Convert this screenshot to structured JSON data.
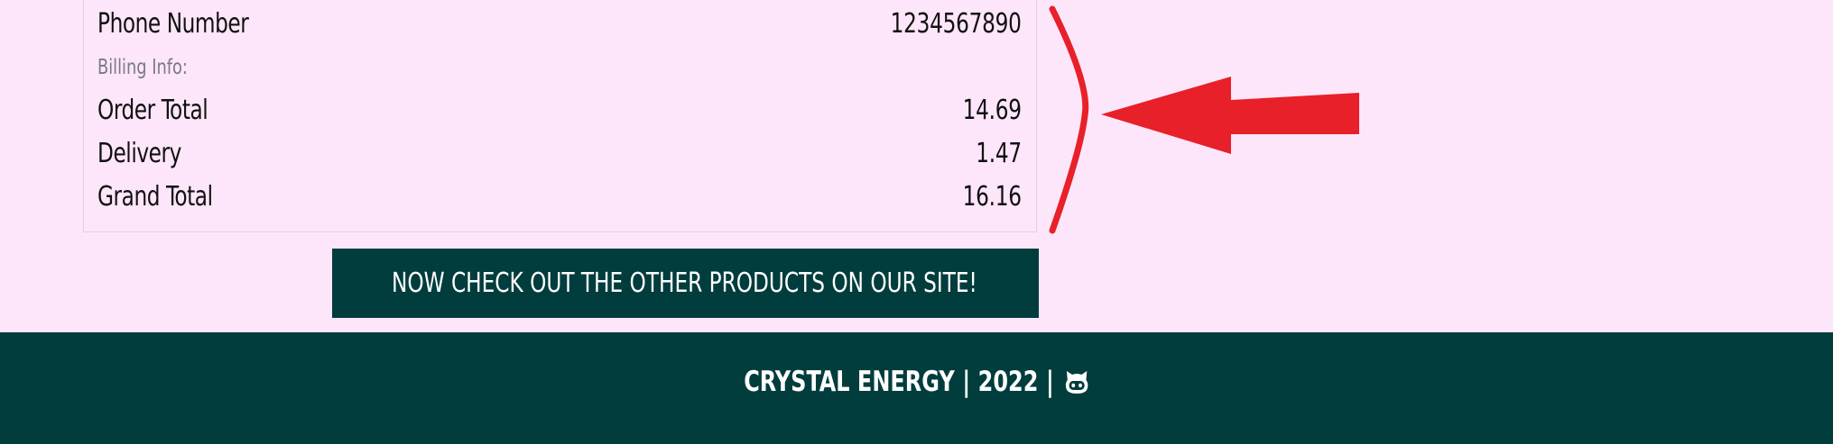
{
  "order_summary": {
    "phone": {
      "label": "Phone Number",
      "value": "1234567890"
    },
    "billing_heading": "Billing Info:",
    "order_total": {
      "label": "Order Total",
      "value": "14.69"
    },
    "delivery": {
      "label": "Delivery",
      "value": "1.47"
    },
    "grand_total": {
      "label": "Grand Total",
      "value": "16.16"
    }
  },
  "cta": {
    "icon": "diamond-icon",
    "label": "NOW CHECK OUT THE OTHER PRODUCTS ON OUR SITE!"
  },
  "footer": {
    "brand": "CRYSTAL ENERGY",
    "year": "2022",
    "separator": "|",
    "icon": "github-icon"
  },
  "colors": {
    "background": "#fde6f9",
    "accent_dark_teal": "#023d3d",
    "annotation_red": "#e8202a"
  }
}
